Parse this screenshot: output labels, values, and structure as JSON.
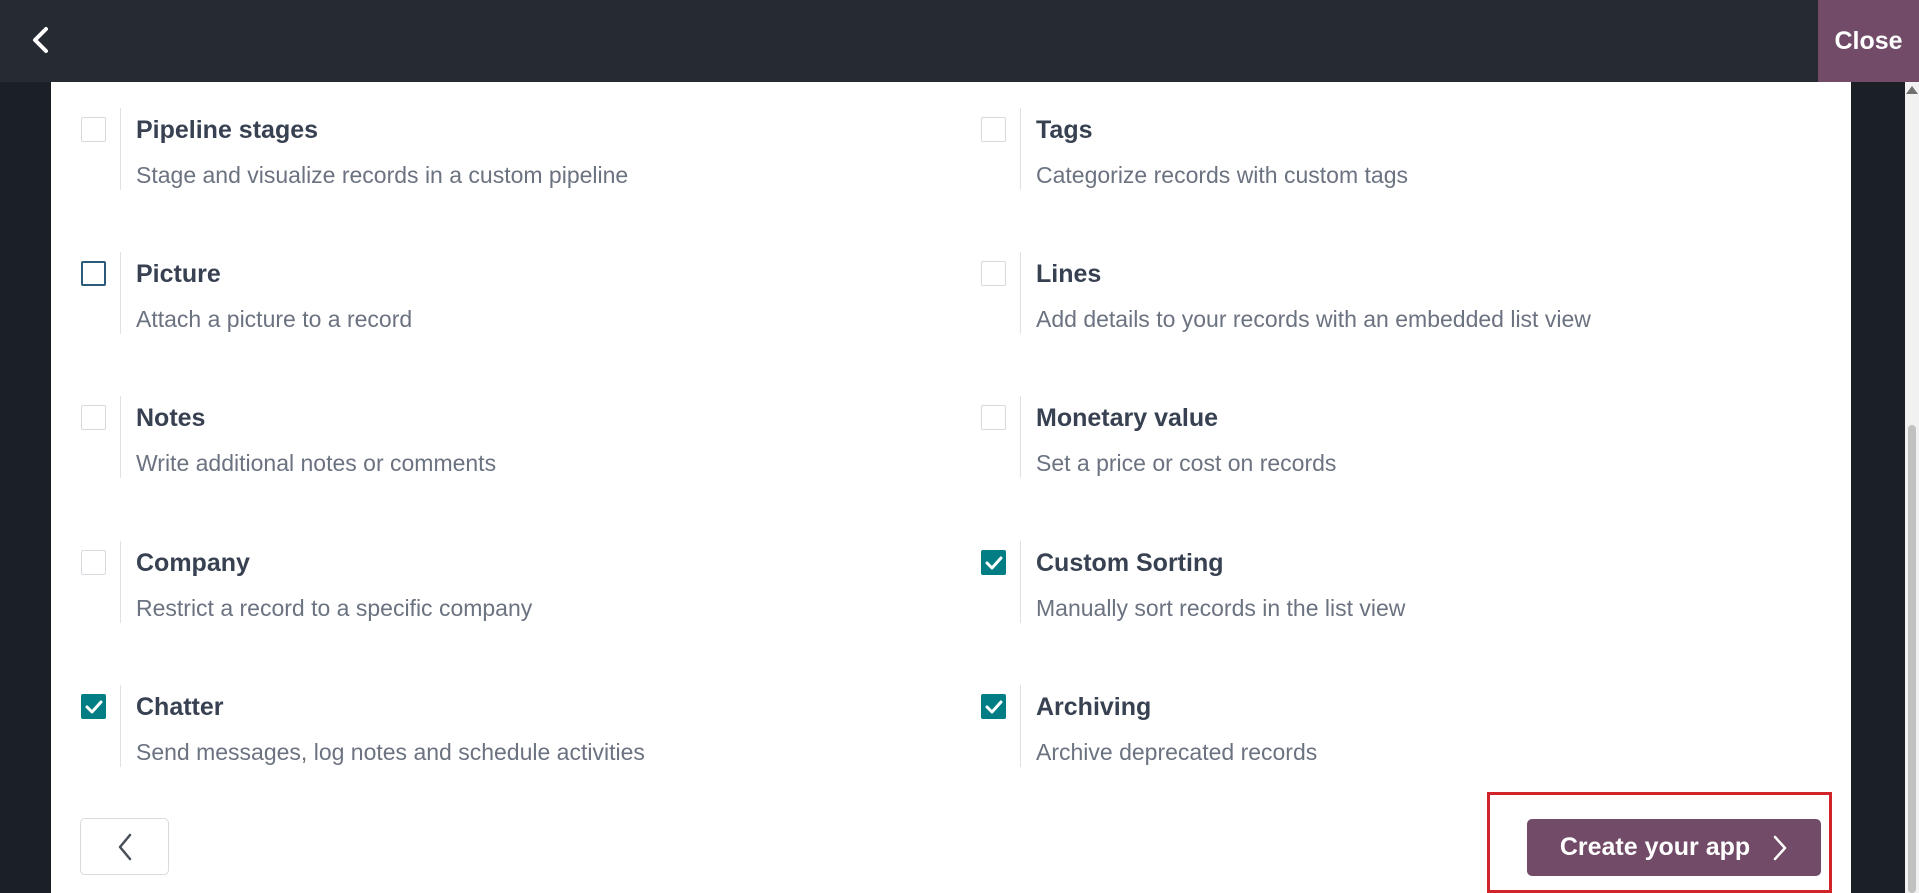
{
  "topbar": {
    "close_label": "Close"
  },
  "options": [
    {
      "title": "Pipeline stages",
      "desc": "Stage and visualize records in a custom pipeline",
      "checked": false
    },
    {
      "title": "Tags",
      "desc": "Categorize records with custom tags",
      "checked": false
    },
    {
      "title": "Picture",
      "desc": "Attach a picture to a record",
      "checked": false
    },
    {
      "title": "Lines",
      "desc": "Add details to your records with an embedded list view",
      "checked": false
    },
    {
      "title": "Notes",
      "desc": "Write additional notes or comments",
      "checked": false
    },
    {
      "title": "Monetary value",
      "desc": "Set a price or cost on records",
      "checked": false
    },
    {
      "title": "Company",
      "desc": "Restrict a record to a specific company",
      "checked": false
    },
    {
      "title": "Custom Sorting",
      "desc": "Manually sort records in the list view",
      "checked": true
    },
    {
      "title": "Chatter",
      "desc": "Send messages, log notes and schedule activities",
      "checked": true
    },
    {
      "title": "Archiving",
      "desc": "Archive deprecated records",
      "checked": true
    }
  ],
  "footer": {
    "create_label": "Create your app"
  },
  "colors": {
    "accent": "#714b67",
    "checkbox": "#017e84",
    "highlight": "#d0232a"
  }
}
